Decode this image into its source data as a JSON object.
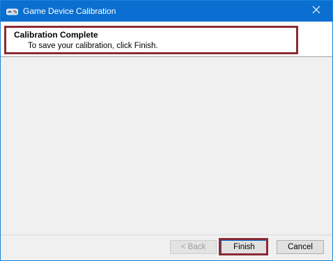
{
  "window": {
    "title": "Game Device Calibration",
    "titlebar_color": "#0a6fd0"
  },
  "header": {
    "title": "Calibration Complete",
    "subtitle": "To save your calibration, click Finish."
  },
  "buttons": {
    "back_label": "< Back",
    "finish_label": "Finish",
    "cancel_label": "Cancel"
  },
  "icons": {
    "app": "game-controller-icon",
    "close": "close-icon"
  },
  "colors": {
    "highlight": "#8b2a34"
  }
}
